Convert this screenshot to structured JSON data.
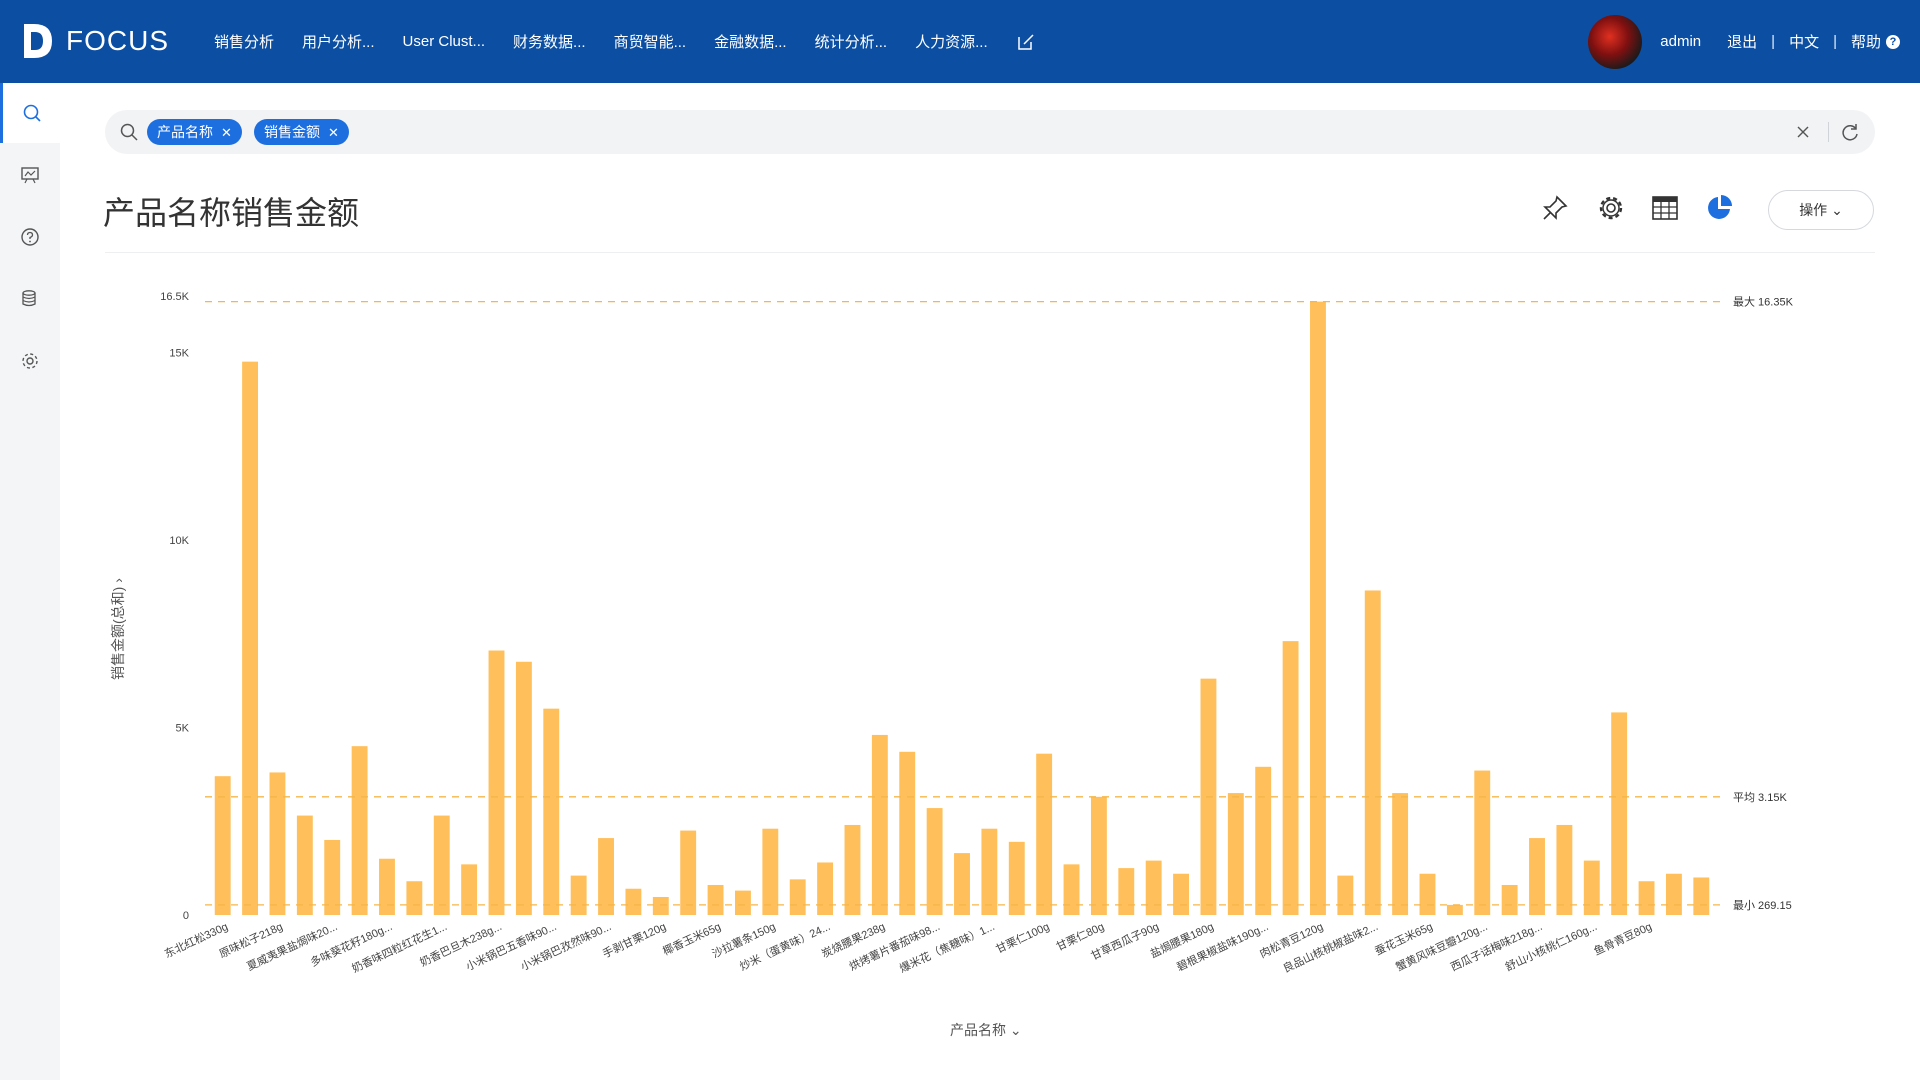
{
  "app": {
    "logo_text": "FOCUS",
    "nav_items": [
      "销售分析",
      "用户分析...",
      "User Clust...",
      "财务数据...",
      "商贸智能...",
      "金融数据...",
      "统计分析...",
      "人力资源..."
    ],
    "user_name": "admin",
    "logout": "退出",
    "language": "中文",
    "help": "帮助",
    "sidebar": [
      "search-icon",
      "dashboard-icon",
      "help-icon",
      "database-icon",
      "settings-icon"
    ]
  },
  "search": {
    "tags": [
      "产品名称",
      "销售金额"
    ]
  },
  "page": {
    "title": "产品名称销售金额",
    "operate_label": "操作"
  },
  "colors": {
    "header": "#0b4ea2",
    "accent": "#1d6fe0",
    "bar": "#ffbf5a",
    "refline": "#f5b64a"
  },
  "chart_data": {
    "type": "bar",
    "xlabel": "产品名称",
    "ylabel": "销售金额(总和)",
    "ylim": [
      0,
      16500
    ],
    "yticks": [
      {
        "value": 0,
        "label": "0"
      },
      {
        "value": 5000,
        "label": "5K"
      },
      {
        "value": 10000,
        "label": "10K"
      },
      {
        "value": 15000,
        "label": "15K"
      },
      {
        "value": 16500,
        "label": "16.5K"
      }
    ],
    "values": [
      3700,
      14750,
      3800,
      2650,
      2000,
      4500,
      1500,
      900,
      2650,
      1350,
      7050,
      6750,
      5500,
      1050,
      2050,
      700,
      480,
      2250,
      800,
      650,
      2300,
      950,
      1400,
      2400,
      4800,
      4350,
      2850,
      1650,
      2300,
      1950,
      4300,
      1350,
      3150,
      1250,
      1450,
      1100,
      6300,
      3250,
      3950,
      7300,
      16350,
      1050,
      8650,
      3250,
      1100,
      269,
      3850,
      800,
      2050,
      2400,
      1450,
      5400,
      900,
      1100,
      1000
    ],
    "tick_labels": [
      "东北红松330g",
      "原味松子218g",
      "夏威夷果盐焗味20...",
      "多味葵花籽180g...",
      "奶香味四粒红花生1...",
      "奶香巴旦木238g...",
      "小米锅巴五香味90...",
      "小米锅巴孜然味90...",
      "手剥甘栗120g",
      "椰香玉米65g",
      "沙拉薯条150g",
      "炒米（蛋黄味）24...",
      "炭烧腰果238g",
      "烘烤薯片番茄味98...",
      "爆米花（焦糖味）1...",
      "甘栗仁100g",
      "甘栗仁80g",
      "甘草西瓜子90g",
      "盐焗腰果180g",
      "碧根果椒盐味190g...",
      "肉松青豆120g",
      "良品山核桃椒盐味2...",
      "蚕花玉米65g",
      "蟹黄风味豆瓣120g...",
      "西瓜子话梅味218g...",
      "舒山小核桃仁160g...",
      "鱼骨青豆80g"
    ],
    "reference_lines": [
      {
        "label": "最大 16.35K",
        "value": 16350
      },
      {
        "label": "平均 3.15K",
        "value": 3150
      },
      {
        "label": "最小 269.15",
        "value": 269.15
      }
    ]
  }
}
